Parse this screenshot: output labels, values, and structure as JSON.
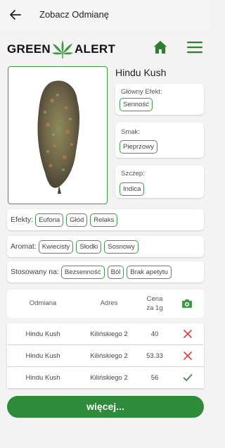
{
  "topbar": {
    "title": "Zobacz Odmianę",
    "back_icon": "arrow-left-icon"
  },
  "header": {
    "logo_left": "GREEN",
    "logo_right": "ALERT",
    "home_icon": "home-icon",
    "menu_icon": "hamburger-menu-icon",
    "accent_color": "#3f9a46"
  },
  "strain": {
    "name": "Hindu Kush",
    "main_effect_label": "Główny Efekt:",
    "main_effect": "Senność",
    "taste_label": "Smak:",
    "taste": "Pieprzowy",
    "type_label": "Szczep:",
    "type": "Indica"
  },
  "effects": {
    "label": "Efekty:",
    "items": [
      "Euforia",
      "Głód",
      "Relaks"
    ]
  },
  "aroma": {
    "label": "Aromat:",
    "items": [
      "Kwiecisty",
      "Słodki",
      "Sosnowy"
    ]
  },
  "usage": {
    "label": "Stosowany na:",
    "items": [
      "Bezsenność",
      "Ból",
      "Brak apetytu"
    ]
  },
  "table": {
    "headers": {
      "strain": "Odmiana",
      "address": "Adres",
      "price_line1": "Cena",
      "price_line2": "za 1g",
      "camera_icon": "camera-icon"
    },
    "rows": [
      {
        "strain": "Hindu Kush",
        "address": "Kilińskiego 2",
        "price": "40",
        "status": "x-icon"
      },
      {
        "strain": "Hindu Kush",
        "address": "Kilińskiego 2",
        "price": "53.33",
        "status": "x-icon"
      },
      {
        "strain": "Hindu Kush",
        "address": "Kilińskiego 2",
        "price": "56",
        "status": "check-icon"
      }
    ]
  },
  "more_button": "więcej..."
}
